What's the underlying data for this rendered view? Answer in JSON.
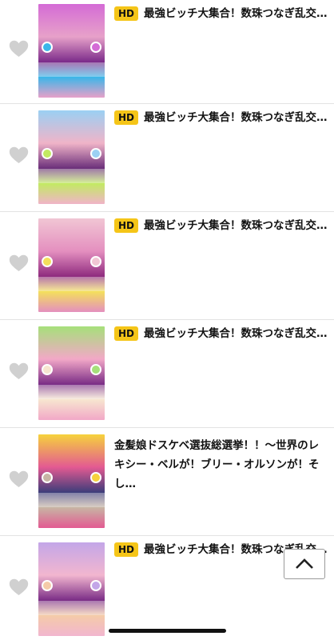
{
  "items": [
    {
      "hd": "HD",
      "title": "最強ビッチ大集合！数珠つなぎ乱交S…",
      "thumb_colors": [
        "#d46bd6",
        "#e7a1c9",
        "#3bb6e9",
        "#7b2b8a"
      ]
    },
    {
      "hd": "HD",
      "title": "最強ビッチ大集合！数珠つなぎ乱交S…",
      "thumb_colors": [
        "#9bd0f3",
        "#f0b4c8",
        "#c2ea62",
        "#6b2f7a"
      ]
    },
    {
      "hd": "HD",
      "title": "最強ビッチ大集合！数珠つなぎ乱交S…",
      "thumb_colors": [
        "#f1c6d4",
        "#e48fbf",
        "#f4e05b",
        "#8f2b7f"
      ]
    },
    {
      "hd": "HD",
      "title": "最強ビッチ大集合！数珠つなぎ乱交S…",
      "thumb_colors": [
        "#a6e07a",
        "#f2a8c7",
        "#f7e6d0",
        "#7a2d86"
      ]
    },
    {
      "hd": "",
      "title": "金髪娘ドスケベ選抜総選挙！！〜世界のレキシー・ベルが！ブリー・オルソンが！そし…",
      "thumb_colors": [
        "#f6d23c",
        "#e35a92",
        "#c7b5a4",
        "#3d3d7a"
      ]
    },
    {
      "hd": "HD",
      "title": "最強ビッチ大集合！数珠つなぎ乱交S…",
      "thumb_colors": [
        "#c3a6e8",
        "#f2b6cf",
        "#f4cba8",
        "#7a2d86"
      ]
    }
  ],
  "icons": {
    "favorite": "heart-outline",
    "scroll_top": "chevron-up"
  },
  "colors": {
    "hd_badge": "#f5c518",
    "heart": "#d0d0d0",
    "divider": "#e3e3e3"
  }
}
